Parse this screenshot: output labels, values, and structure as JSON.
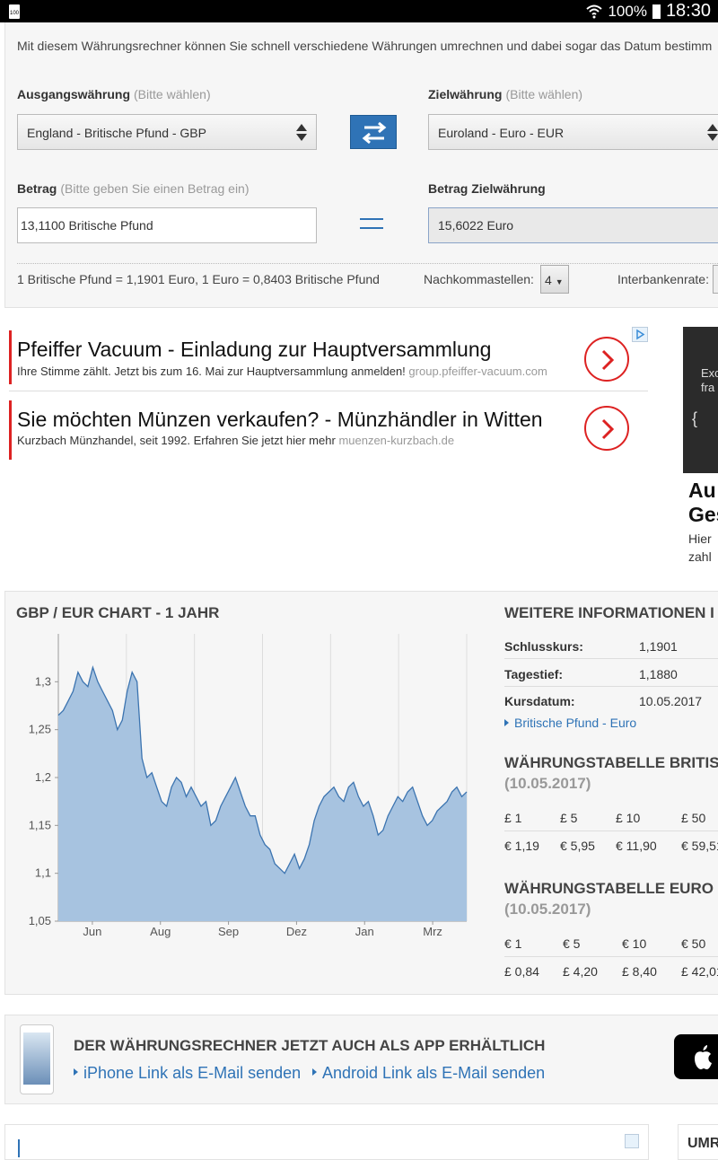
{
  "status_bar": {
    "battery_left": "100",
    "battery_pct": "100%",
    "time": "18:30"
  },
  "converter": {
    "intro": "Mit diesem Währungsrechner können Sie schnell verschiedene Währungen umrechnen und dabei sogar das Datum bestimm",
    "source_label": "Ausgangswährung",
    "source_hint": "(Bitte wählen)",
    "source_value": "England - Britische Pfund - GBP",
    "target_label": "Zielwährung",
    "target_hint": "(Bitte wählen)",
    "target_value": "Euroland - Euro - EUR",
    "amount_label": "Betrag",
    "amount_hint": "(Bitte geben Sie einen Betrag ein)",
    "amount_value": "13,1100 Britische Pfund",
    "target_amount_label": "Betrag Zielwährung",
    "target_amount_value": "15,6022 Euro",
    "rate_text": "1 Britische Pfund = 1,1901 Euro, 1 Euro = 0,8403 Britische Pfund",
    "decimals_label": "Nachkommastellen:",
    "decimals_value": "4",
    "interbank_label": "Interbankenrate:"
  },
  "ads": [
    {
      "title": "Pfeiffer Vacuum - Einladung zur Hauptversammlung",
      "desc": "Ihre Stimme zählt. Jetzt bis zum 16. Mai zur Hauptversammlung anmelden!",
      "url": "group.pfeiffer-vacuum.com"
    },
    {
      "title": "Sie möchten Münzen verkaufen? - Münzhändler in Witten",
      "desc": "Kurzbach Münzhandel, seit 1992. Erfahren Sie jetzt hier mehr",
      "url": "muenzen-kurzbach.de"
    }
  ],
  "side_ad": {
    "img_line1": "Exc",
    "img_line2": "fra",
    "img_brace": "{",
    "title_line1": "Au",
    "title_line2": "Ges",
    "desc_line1": "Hier",
    "desc_line2": "zahl"
  },
  "chart_section": {
    "title": "GBP / EUR CHART - 1 JAHR"
  },
  "chart_data": {
    "type": "area",
    "title": "GBP / EUR CHART - 1 JAHR",
    "x": [
      "Jun",
      "Aug",
      "Sep",
      "Dez",
      "Jan",
      "Mrz"
    ],
    "ylim": [
      1.05,
      1.35
    ],
    "y_ticks": [
      "1,05",
      "1,1",
      "1,15",
      "1,2",
      "1,25",
      "1,3"
    ],
    "grid": true,
    "series": [
      {
        "values": [
          1.265,
          1.27,
          1.28,
          1.29,
          1.31,
          1.3,
          1.295,
          1.315,
          1.3,
          1.29,
          1.28,
          1.27,
          1.25,
          1.26,
          1.29,
          1.31,
          1.3,
          1.22,
          1.2,
          1.205,
          1.19,
          1.175,
          1.17,
          1.19,
          1.2,
          1.195,
          1.18,
          1.19,
          1.18,
          1.17,
          1.175,
          1.15,
          1.155,
          1.17,
          1.18,
          1.19,
          1.2,
          1.185,
          1.17,
          1.16,
          1.16,
          1.14,
          1.13,
          1.125,
          1.11,
          1.105,
          1.1,
          1.11,
          1.12,
          1.105,
          1.115,
          1.13,
          1.155,
          1.17,
          1.18,
          1.185,
          1.19,
          1.18,
          1.175,
          1.19,
          1.195,
          1.18,
          1.17,
          1.175,
          1.16,
          1.14,
          1.145,
          1.16,
          1.17,
          1.18,
          1.175,
          1.185,
          1.19,
          1.175,
          1.16,
          1.15,
          1.155,
          1.165,
          1.17,
          1.175,
          1.185,
          1.19,
          1.18,
          1.185
        ]
      }
    ]
  },
  "info": {
    "title": "WEITERE INFORMATIONEN I",
    "rows": [
      {
        "k": "Schlusskurs:",
        "v": "1,1901"
      },
      {
        "k": "Tagestief:",
        "v": "1,1880"
      },
      {
        "k": "Kursdatum:",
        "v": "10.05.2017"
      }
    ],
    "link": "Britische Pfund - Euro"
  },
  "table_gbp": {
    "title": "WÄHRUNGSTABELLE BRITIS",
    "date": "(10.05.2017)",
    "header": [
      "£ 1",
      "£ 5",
      "£ 10",
      "£ 50"
    ],
    "values": [
      "€ 1,19",
      "€ 5,95",
      "€ 11,90",
      "€ 59,51"
    ]
  },
  "table_eur": {
    "title": "WÄHRUNGSTABELLE EURO (",
    "date": "(10.05.2017)",
    "header": [
      "€ 1",
      "€ 5",
      "€ 10",
      "€ 50"
    ],
    "values": [
      "£ 0,84",
      "£ 4,20",
      "£ 8,40",
      "£ 42,01"
    ]
  },
  "app": {
    "title": "DER WÄHRUNGSRECHNER JETZT AUCH ALS APP ERHÄLTLICH",
    "iphone_link": "iPhone Link als E-Mail senden",
    "android_link": "Android Link als E-Mail senden"
  },
  "bottom": {
    "right_title": "UMR"
  }
}
